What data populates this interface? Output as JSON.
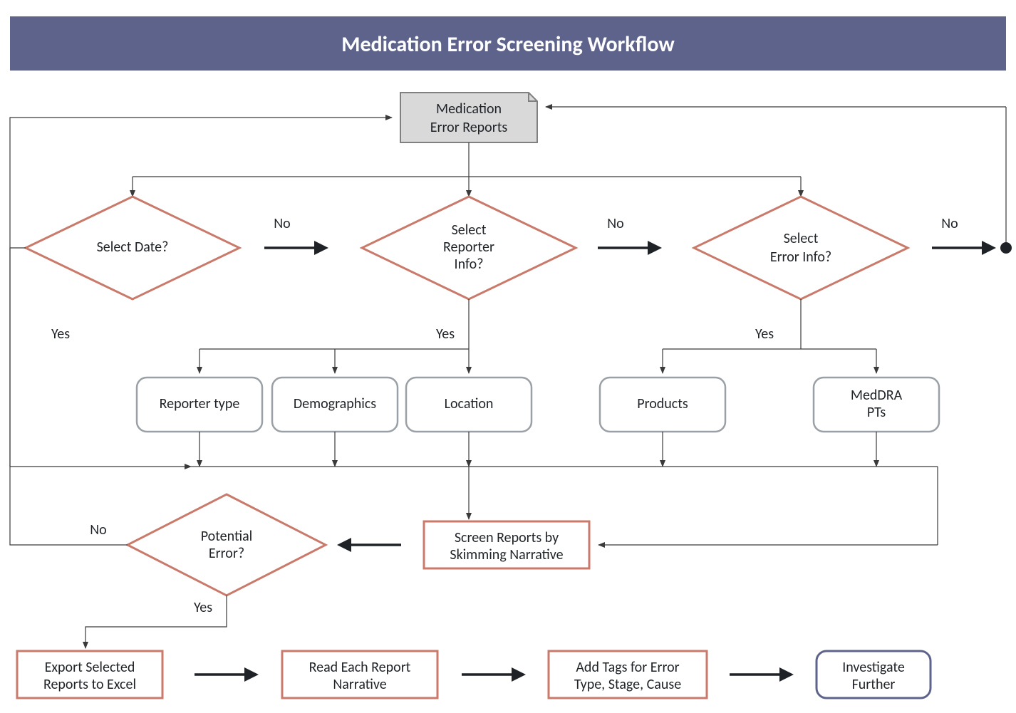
{
  "title": "Medication Error Screening Workflow",
  "start": {
    "label1": "Medication",
    "label2": "Error Reports"
  },
  "decisions": {
    "date": {
      "label": "Select Date?"
    },
    "reporter": {
      "label1": "Select",
      "label2": "Reporter",
      "label3": "Info?"
    },
    "error": {
      "label1": "Select",
      "label2": "Error Info?"
    },
    "potential": {
      "label1": "Potential",
      "label2": "Error?"
    }
  },
  "labels": {
    "yes": "Yes",
    "no": "No"
  },
  "filters": {
    "reporterType": "Reporter type",
    "demographics": "Demographics",
    "location": "Location",
    "products": "Products",
    "meddra1": "MedDRA",
    "meddra2": "PTs"
  },
  "processes": {
    "screen1": "Screen Reports by",
    "screen2": "Skimming Narrative",
    "export1": "Export Selected",
    "export2": "Reports to Excel",
    "read1": "Read Each Report",
    "read2": "Narrative",
    "tags1": "Add Tags for Error",
    "tags2": "Type, Stage, Cause",
    "investigate1": "Investigate",
    "investigate2": "Further"
  }
}
